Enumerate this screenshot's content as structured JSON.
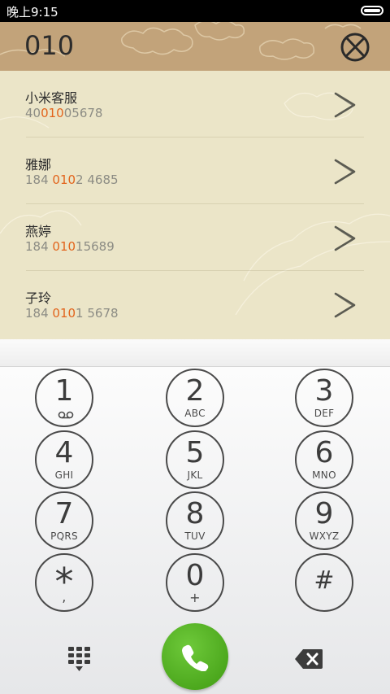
{
  "status_bar": {
    "time": "晚上9:15"
  },
  "dialed_number": "010",
  "results": [
    {
      "name": "小米客服",
      "phone_pre": "40",
      "phone_match": "010",
      "phone_post": "05678"
    },
    {
      "name": "雅娜",
      "phone_pre": "184 ",
      "phone_match": "010",
      "phone_post": "2 4685"
    },
    {
      "name": "燕婷",
      "phone_pre": "184 ",
      "phone_match": "010",
      "phone_post": "15689"
    },
    {
      "name": "子玲",
      "phone_pre": "184 ",
      "phone_match": "010",
      "phone_post": "1 5678"
    }
  ],
  "keys": [
    {
      "digit": "1",
      "letters": ""
    },
    {
      "digit": "2",
      "letters": "ABC"
    },
    {
      "digit": "3",
      "letters": "DEF"
    },
    {
      "digit": "4",
      "letters": "GHI"
    },
    {
      "digit": "5",
      "letters": "JKL"
    },
    {
      "digit": "6",
      "letters": "MNO"
    },
    {
      "digit": "7",
      "letters": "PQRS"
    },
    {
      "digit": "8",
      "letters": "TUV"
    },
    {
      "digit": "9",
      "letters": "WXYZ"
    },
    {
      "digit": "*",
      "letters": ","
    },
    {
      "digit": "0",
      "letters": "+"
    },
    {
      "digit": "#",
      "letters": ""
    }
  ],
  "icons": {
    "clear": "clear-circle-x-icon",
    "chevron": "chevron-right-icon",
    "voicemail": "voicemail-icon",
    "dialpad": "dialpad-icon",
    "call": "phone-icon",
    "backspace": "backspace-icon"
  },
  "colors": {
    "header_bg": "#c2a37a",
    "results_bg": "#ebe5c8",
    "highlight": "#e2641c",
    "call_green": "#4aa61c"
  }
}
